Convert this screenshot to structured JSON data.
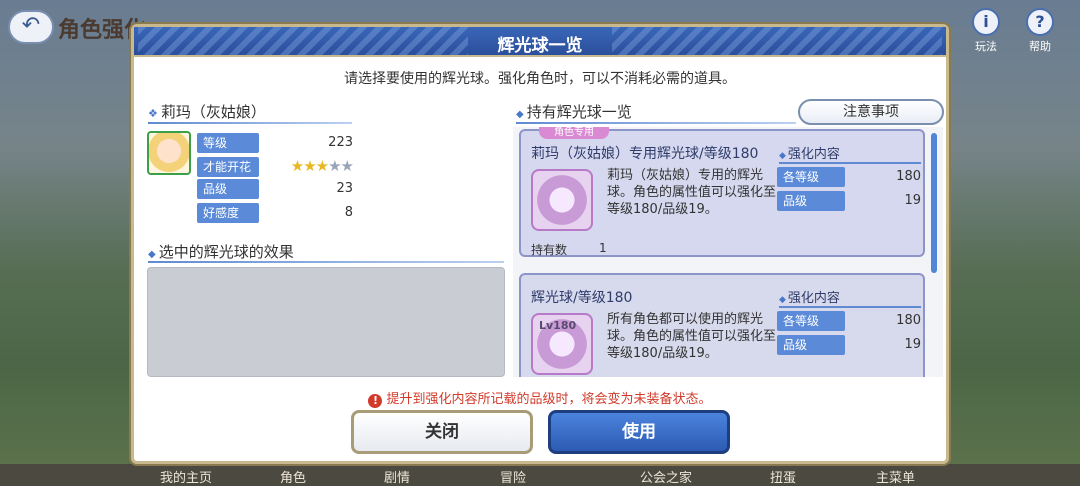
{
  "background": {
    "title": "角色强化",
    "top_icons": [
      {
        "name": "help-icon",
        "label": "玩法",
        "glyph": "i"
      },
      {
        "name": "question-icon",
        "label": "帮助",
        "glyph": "?"
      }
    ],
    "bottom_nav": [
      "我的主页",
      "角色",
      "剧情",
      "冒险",
      "公会之家",
      "扭蛋",
      "主菜单"
    ]
  },
  "dialog": {
    "title": "辉光球一览",
    "instruction": "请选择要使用的辉光球。强化角色时，可以不消耗必需的道具。",
    "character": {
      "name": "莉玛（灰姑娘）",
      "stats": [
        {
          "label": "等级",
          "value": "223"
        },
        {
          "label": "才能开花",
          "stars_filled": 3,
          "stars_total": 5
        },
        {
          "label": "品级",
          "value": "23"
        },
        {
          "label": "好感度",
          "value": "8"
        }
      ]
    },
    "effect_section_title": "选中的辉光球的效果",
    "list_title": "持有辉光球一览",
    "notes_button": "注意事项",
    "cards": [
      {
        "tag": "角色专用",
        "name": "莉玛（灰姑娘）专用辉光球/等级180",
        "icon_label": "",
        "description": "莉玛（灰姑娘）专用的辉光球。角色的属性值可以强化至等级180/品级19。",
        "owned_label": "持有数",
        "owned_value": "1",
        "boost_title": "强化内容",
        "boosts": [
          {
            "label": "各等级",
            "value": "180"
          },
          {
            "label": "品级",
            "value": "19"
          }
        ]
      },
      {
        "tag": "",
        "name": "辉光球/等级180",
        "icon_label": "Lv180",
        "description": "所有角色都可以使用的辉光球。角色的属性值可以强化至等级180/品级19。",
        "owned_label": "",
        "owned_value": "",
        "boost_title": "强化内容",
        "boosts": [
          {
            "label": "各等级",
            "value": "180"
          },
          {
            "label": "品级",
            "value": "19"
          }
        ]
      }
    ],
    "warning": "提升到强化内容所记载的品级时，将会变为未装备状态。",
    "close_button": "关闭",
    "use_button": "使用"
  }
}
